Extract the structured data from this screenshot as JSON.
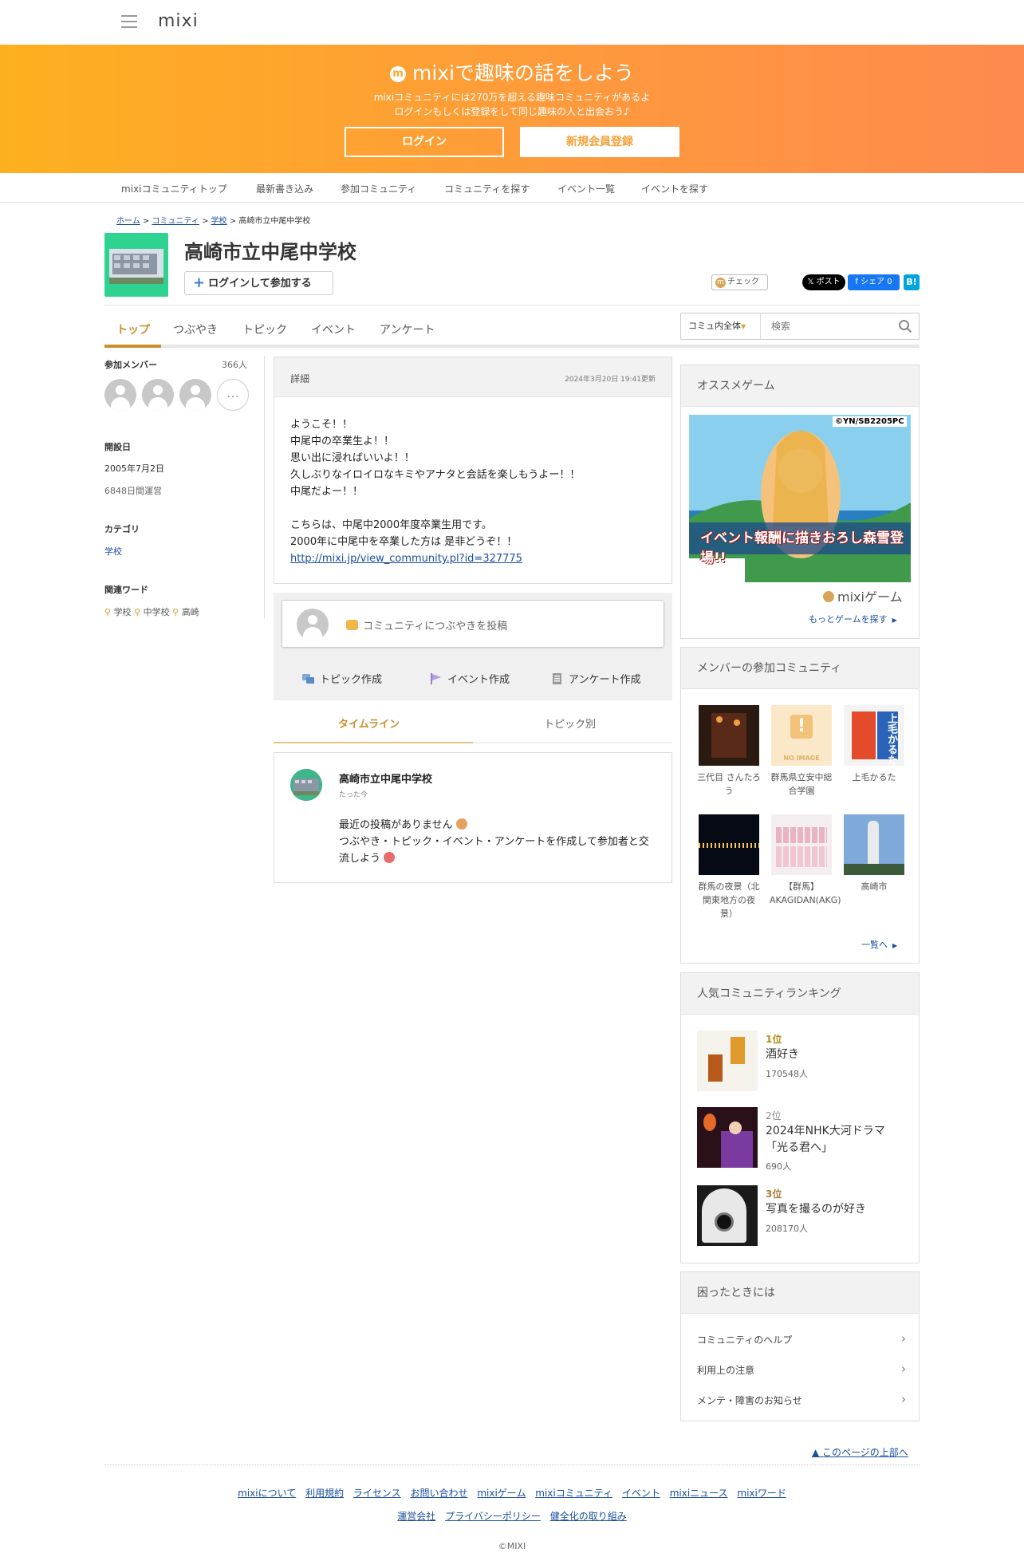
{
  "header": {
    "logo": "mixi"
  },
  "banner": {
    "title": "mixiで趣味の話をしよう",
    "logo_mark": "m",
    "sub1": "mixiコミュニティには270万を超える趣味コミュニティがあるよ",
    "sub2": "ログインもしくは登録をして同じ趣味の人と出会おう♪",
    "login": "ログイン",
    "register": "新規会員登録"
  },
  "nav": [
    "mixiコミュニティトップ",
    "最新書き込み",
    "参加コミュニティ",
    "コミュニティを探す",
    "イベント一覧",
    "イベントを探す"
  ],
  "breadcrumb": {
    "home": "ホーム",
    "sep": ">",
    "community": "コミュニティ",
    "school": "学校",
    "current": "高崎市立中尾中学校"
  },
  "community": {
    "title": "高崎市立中尾中学校",
    "join": "ログインして参加する",
    "join_plus": "+",
    "check": "チェック",
    "check_mark": "m",
    "x_label": "𝕏 ポスト",
    "fb_label": "f シェア 0",
    "hb_label": "B!"
  },
  "tabs": [
    "トップ",
    "つぶやき",
    "トピック",
    "イベント",
    "アンケート"
  ],
  "search": {
    "scope": "コミュ内全体",
    "caret": "▼",
    "placeholder": "検索"
  },
  "left": {
    "members_label": "参加メンバー",
    "members_count": "366人",
    "more": "…",
    "founded_label": "開設日",
    "founded_date": "2005年7月2日",
    "days": "6848日間運営",
    "category_label": "カテゴリ",
    "category": "学校",
    "keywords_label": "関連ワード",
    "keywords": [
      "学校",
      "中学校",
      "高崎"
    ]
  },
  "detail": {
    "label": "詳細",
    "updated": "2024年3月20日 19:41更新",
    "body": "ようこそ！！\n中尾中の卒業生よ！！\n思い出に浸ればいいよ！！\n久しぶりなイロイロなキミやアナタと会話を楽しもうよー！！\n中尾だよー！！\n\nこちらは、中尾中2000年度卒業生用です。\n2000年に中尾中を卒業した方は 是非どうぞ！！",
    "link": "http://mixi.jp/view_community.pl?id=327775"
  },
  "post": {
    "placeholder": "コミュニティにつぶやきを投稿",
    "topic": "トピック作成",
    "event": "イベント作成",
    "survey": "アンケート作成"
  },
  "timeline": {
    "tab_timeline": "タイムライン",
    "tab_topic": "トピック別",
    "name": "高崎市立中尾中学校",
    "time": "たった今",
    "msg1": "最近の投稿がありません",
    "msg2": "つぶやき・トピック・イベント・アンケートを作成して参加者と交流しよう"
  },
  "game": {
    "title": "オススメゲーム",
    "banner_top": "©YN/SB2205PC",
    "banner_text": "イベント報酬に描きおろし森雪登場!!",
    "brand": "mixiゲーム",
    "more": "もっとゲームを探す",
    "tri": "▶"
  },
  "member_comms": {
    "title": "メンバーの参加コミュニティ",
    "items": [
      {
        "name": "三代目 さんたろう"
      },
      {
        "name": "群馬県立安中総合学園",
        "noimage": "NO IMAGE"
      },
      {
        "name": "上毛かるた",
        "thumb": "上毛かるた"
      },
      {
        "name": "群馬の夜景（北関東地方の夜景）"
      },
      {
        "name": "【群馬】AKAGIDAN(AKG)"
      },
      {
        "name": "高崎市"
      }
    ],
    "more": "一覧へ",
    "tri": "▶"
  },
  "ranking": {
    "title": "人気コミュニティランキング",
    "items": [
      {
        "rank": "1位",
        "name": "酒好き",
        "count": "170548人"
      },
      {
        "rank": "2位",
        "name": "2024年NHK大河ドラマ「光る君へ」",
        "count": "690人"
      },
      {
        "rank": "3位",
        "name": "写真を撮るのが好き",
        "count": "208170人"
      }
    ]
  },
  "help": {
    "title": "困ったときには",
    "items": [
      "コミュニティのヘルプ",
      "利用上の注意",
      "メンテ・障害のお知らせ"
    ],
    "chev": "›"
  },
  "footer": {
    "pagetop": "▲ このページの上部へ",
    "links1": [
      "mixiについて",
      "利用規約",
      "ライセンス",
      "お問い合わせ",
      "mixiゲーム",
      "mixiコミュニティ",
      "イベント",
      "mixiニュース",
      "mixiワード"
    ],
    "links2": [
      "運営会社",
      "プライバシーポリシー",
      "健全化の取り組み"
    ],
    "copyright": "©MIXI"
  },
  "colors": {
    "accent": "#c8902f",
    "banner_start": "#fdb01f",
    "banner_end": "#fe8a4e",
    "link": "#1a4fa0"
  }
}
